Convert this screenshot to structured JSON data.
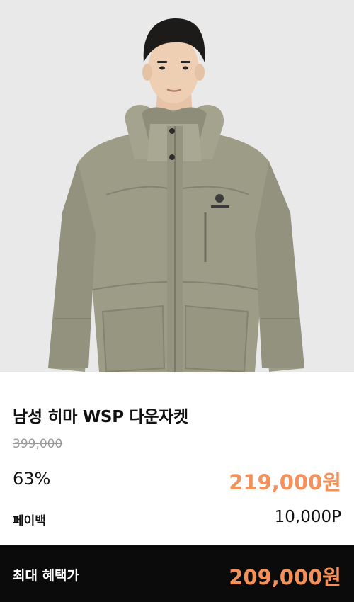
{
  "product": {
    "image_icon": "product-photo-down-jacket",
    "title": "남성 히마 WSP 다운자켓",
    "original_price": "399,000",
    "discount_rate": "63%",
    "sale_price": "219,000원"
  },
  "payback": {
    "label": "페이백",
    "value": "10,000P"
  },
  "benefit_bar": {
    "label": "최대 혜택가",
    "value": "209,000원"
  },
  "colors": {
    "accent": "#f4915a",
    "bar_background": "#0b0b0b",
    "jacket": "#9c9b87"
  }
}
